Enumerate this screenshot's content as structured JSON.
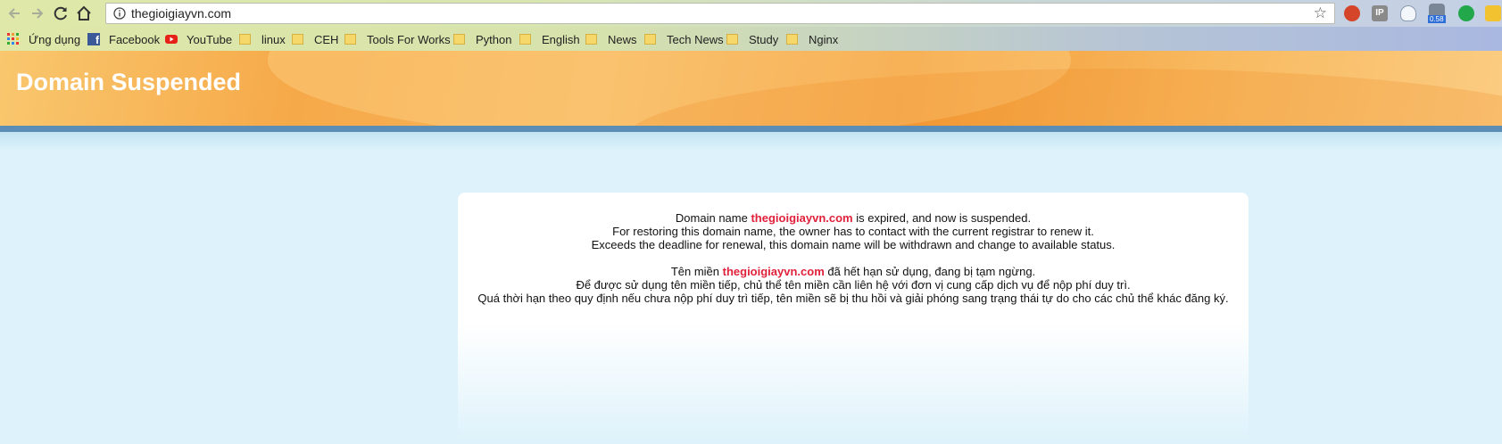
{
  "browser": {
    "url": "thegioigiayvn.com",
    "extensions": [
      {
        "name": "extension-fox-icon",
        "color": "#d4452a"
      },
      {
        "name": "extension-ip-icon",
        "color": "#8a8a8a"
      },
      {
        "name": "extension-cloud-icon",
        "color": "#e8f0f8"
      },
      {
        "name": "extension-speed-icon",
        "color": "#6b7a8c",
        "badge": "0.58"
      },
      {
        "name": "extension-grammarly-icon",
        "color": "#22a84a"
      },
      {
        "name": "extension-more-icon",
        "color": "#f2c230"
      }
    ],
    "bookmarks": [
      {
        "label": "Ứng dụng",
        "icon": "apps-grid-icon"
      },
      {
        "label": "Facebook",
        "icon": "facebook-icon"
      },
      {
        "label": "YouTube",
        "icon": "youtube-icon"
      },
      {
        "label": "linux",
        "icon": "folder-icon"
      },
      {
        "label": "CEH",
        "icon": "folder-icon"
      },
      {
        "label": "Tools For Works",
        "icon": "folder-icon"
      },
      {
        "label": "Python",
        "icon": "folder-icon"
      },
      {
        "label": "English",
        "icon": "folder-icon"
      },
      {
        "label": "News",
        "icon": "folder-icon"
      },
      {
        "label": "Tech News",
        "icon": "folder-icon"
      },
      {
        "label": "Study",
        "icon": "folder-icon"
      },
      {
        "label": "Nginx",
        "icon": "folder-icon"
      }
    ]
  },
  "page": {
    "title": "Domain Suspended",
    "domain": "thegioigiayvn.com",
    "en": {
      "line1_pre": "Domain name ",
      "line1_post": " is expired, and now is suspended.",
      "line2": "For restoring this domain name, the owner has to contact with the current registrar to renew it.",
      "line3": "Exceeds the deadline for renewal, this domain name will be withdrawn and change to available status."
    },
    "vi": {
      "line1_pre": "Tên miền ",
      "line1_post": " đã hết hạn sử dụng, đang bị tạm ngừng.",
      "line2": "Để được sử dụng tên miền tiếp, chủ thể tên miền cần liên hệ với đơn vị cung cấp dịch vụ để nộp phí duy trì.",
      "line3": "Quá thời hạn theo quy định nếu chưa nộp phí duy trì tiếp, tên miền sẽ bị thu hồi và giải phóng sang trạng thái tự do cho các chủ thể khác đăng ký."
    }
  },
  "colors": {
    "header_orange": "#f6a949",
    "stripe_blue": "#5c8db4",
    "background": "#ddf2fb",
    "domain_red": "#e0213b"
  }
}
